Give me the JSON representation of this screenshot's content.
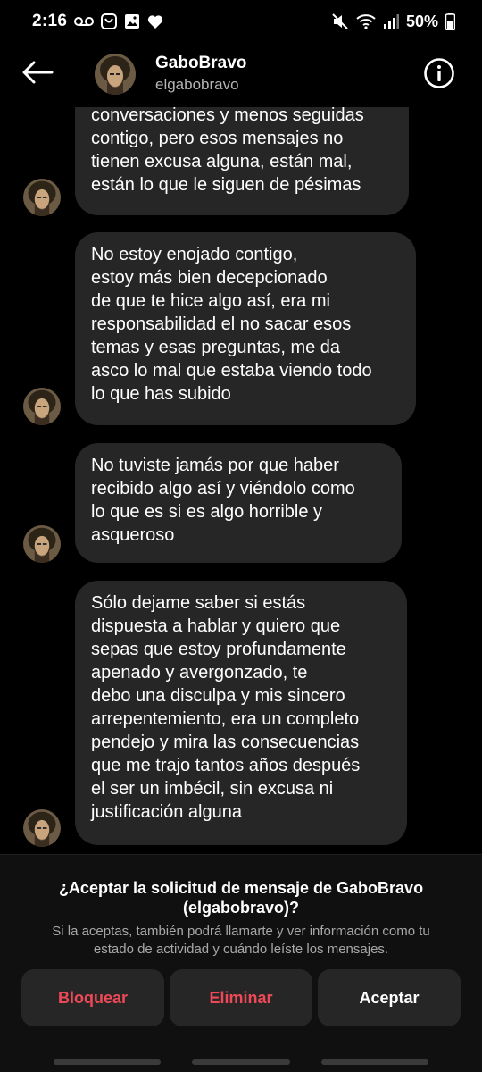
{
  "status_bar": {
    "time": "2:16",
    "battery": "50%"
  },
  "header": {
    "name": "GaboBravo",
    "handle": "elgabobravo"
  },
  "messages": [
    {
      "text": "conversaciones y menos seguidas\ncontigo, pero esos mensajes no\ntienen excusa alguna, están mal,\nestán lo que le siguen de pésimas"
    },
    {
      "text": "No estoy enojado contigo,\nestoy más bien decepcionado\nde que te hice algo así, era mi\nresponsabilidad el no sacar esos\ntemas y esas preguntas, me da\nasco lo mal que estaba viendo todo\nlo que has subido"
    },
    {
      "text": "No tuviste jamás por que haber\nrecibido algo así y viéndolo como\nlo que es si es algo horrible y\nasqueroso"
    },
    {
      "text": "Sólo dejame saber si estás\ndispuesta a hablar y quiero que\nsepas que estoy profundamente\napenado y avergonzado, te\ndebo una disculpa y mis sincero\narrepentemiento, era un completo\npendejo y mira las consecuencias\nque me trajo tantos años después\nel ser un imbécil, sin excusa ni\njustificación alguna"
    }
  ],
  "request": {
    "title": "¿Aceptar la solicitud de mensaje de GaboBravo\n(elgabobravo)?",
    "description": "Si la aceptas, también podrá llamarte y ver información como tu\nestado de actividad y cuándo leíste los mensajes.",
    "block_label": "Bloquear",
    "delete_label": "Eliminar",
    "accept_label": "Aceptar"
  },
  "colors": {
    "background": "#000000",
    "bubble": "#262626",
    "danger": "#ed4956",
    "muted_text": "#a8a8a8"
  },
  "icons": {
    "back": "back-arrow-icon",
    "info": "info-icon",
    "voicemail": "voicemail-icon",
    "mute": "mute-icon",
    "wifi": "wifi-icon",
    "signal": "signal-icon",
    "battery": "battery-icon"
  }
}
